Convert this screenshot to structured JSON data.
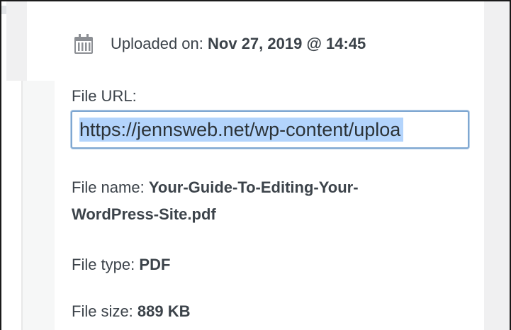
{
  "upload": {
    "label": "Uploaded on:",
    "value": "Nov 27, 2019 @ 14:45"
  },
  "file_url": {
    "label": "File URL:",
    "value": "https://jennsweb.net/wp-content/uploa"
  },
  "file_name": {
    "label": "File name:",
    "value": "Your-Guide-To-Editing-Your-WordPress-Site.pdf"
  },
  "file_type": {
    "label": "File type:",
    "value": "PDF"
  },
  "file_size": {
    "label": "File size:",
    "value": "889 KB"
  },
  "icons": {
    "calendar": "calendar-icon"
  },
  "colors": {
    "text": "#3c434a",
    "input_border": "#7fa7d1",
    "selection": "#b3d4fc",
    "side_panel": "#f0f0f1"
  }
}
